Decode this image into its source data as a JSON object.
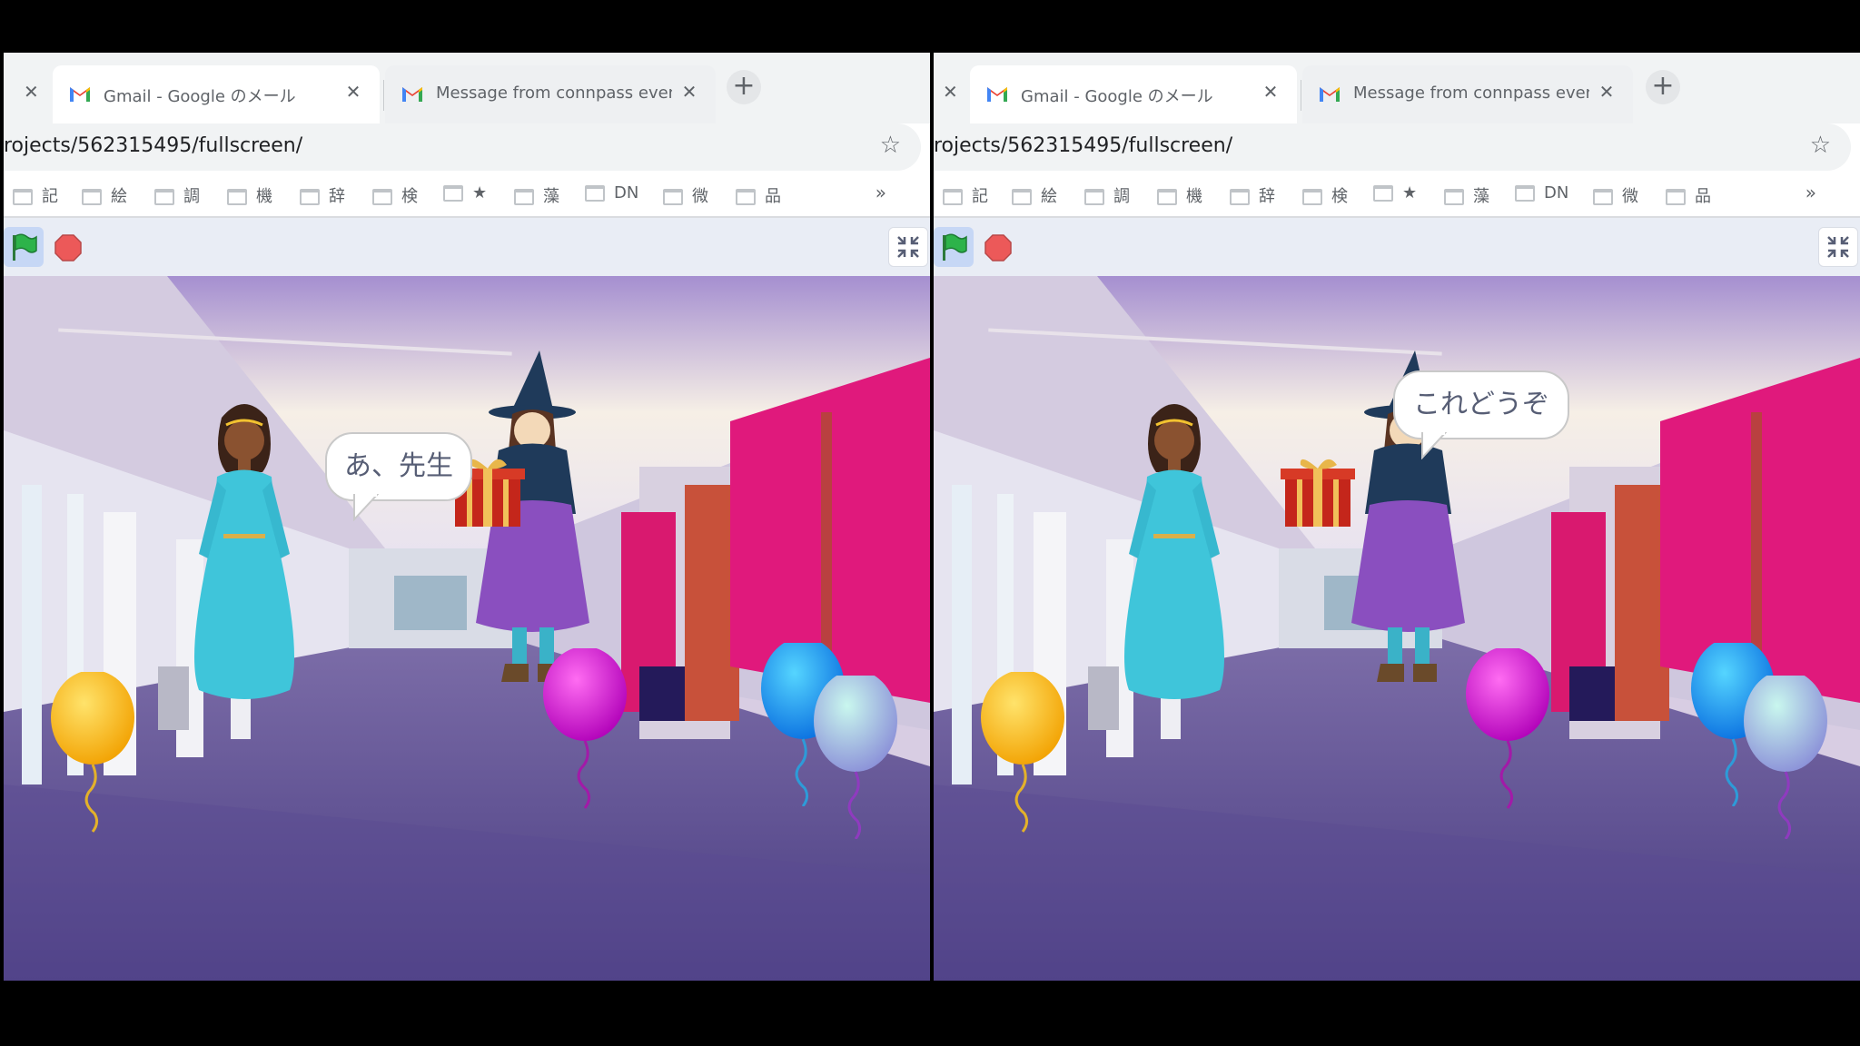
{
  "frames": [
    {
      "id": "left",
      "tabs": [
        {
          "title": "Gmail - Google のメール"
        },
        {
          "title": "Message from connpass event"
        }
      ],
      "url": "rojects/562315495/fullscreen/",
      "speech": "あ、先生"
    },
    {
      "id": "right",
      "tabs": [
        {
          "title": "Gmail - Google のメール"
        },
        {
          "title": "Message from connpass event"
        }
      ],
      "url": "rojects/562315495/fullscreen/",
      "speech": "これどうぞ"
    }
  ],
  "bookmarks": [
    "記",
    "絵",
    "調",
    "機",
    "辞",
    "検",
    "★",
    "藻",
    "DN",
    "微",
    "品"
  ],
  "bookmarks_more": "»",
  "new_tab": "+",
  "close_glyph": "✕",
  "star_glyph": "☆",
  "colors": {
    "magenta_wall": "#e0197c",
    "floor": "#5b4a8a",
    "dress_cyan": "#3fc5da",
    "witch_purple": "#8a4fbf"
  }
}
